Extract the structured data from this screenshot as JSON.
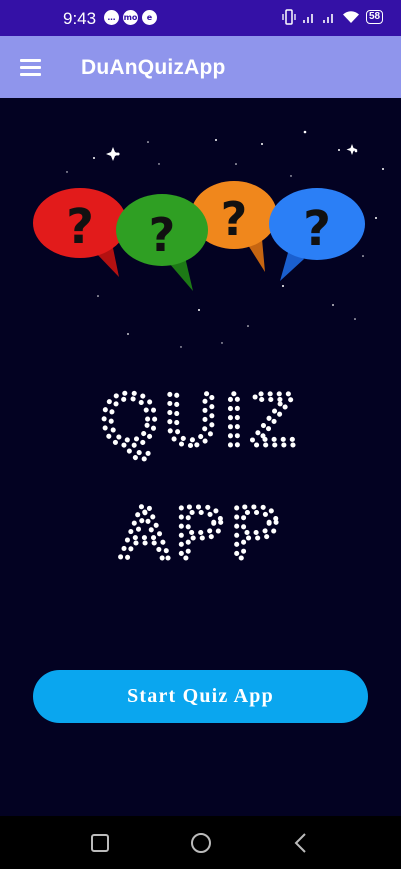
{
  "status_bar": {
    "time": "9:43",
    "left_icons": [
      "messenger-icon",
      "momo-icon",
      "app-icon"
    ],
    "momo_label": "mo",
    "battery": "58"
  },
  "app_bar": {
    "title": "DuAnQuizApp",
    "menu_icon": "hamburger-menu-icon"
  },
  "hero": {
    "bubble_colors": [
      "#e21b1b",
      "#2f9f23",
      "#f0871c",
      "#2b7ff6"
    ],
    "bubble_glyph": "?"
  },
  "title_art": {
    "line1": "QUIZ",
    "line2": "APP"
  },
  "start_button": {
    "label": "Start Quiz App",
    "color": "#0aa6ef"
  },
  "nav": {
    "recents": "square-icon",
    "home": "circle-icon",
    "back": "back-triangle-icon"
  }
}
